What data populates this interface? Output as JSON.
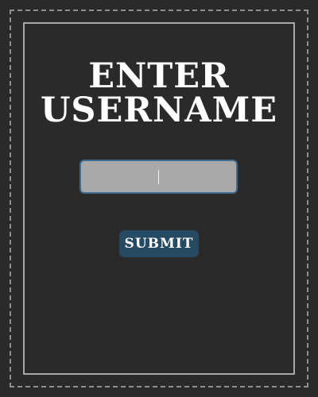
{
  "form": {
    "heading_line1": "ENTER",
    "heading_line2": "USERNAME",
    "username_input": {
      "value": "",
      "placeholder": ""
    },
    "submit_label": "SUBMIT"
  },
  "colors": {
    "background": "#2b2a2a",
    "frame": "#a7a7a7",
    "input_bg": "#a9a9a9",
    "input_border": "#3f6c8f",
    "button_bg": "#264a62",
    "text": "#ffffff"
  }
}
